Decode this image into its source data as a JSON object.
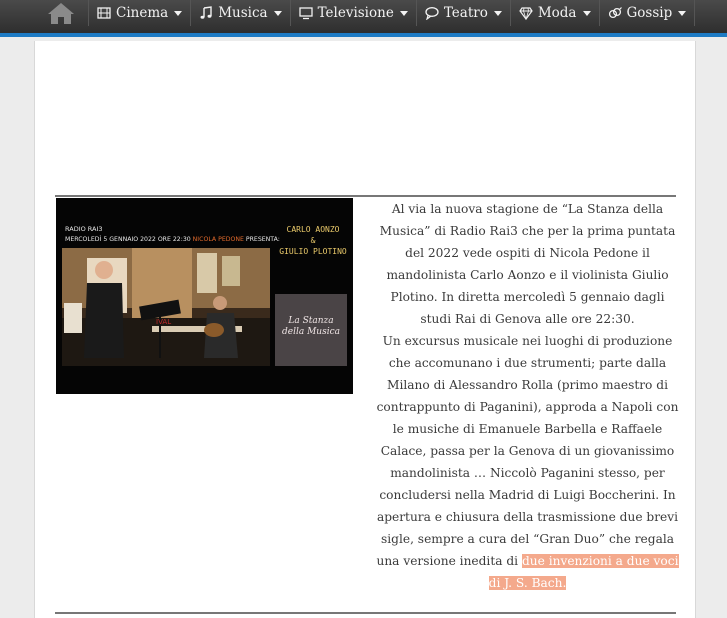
{
  "nav": {
    "items": [
      {
        "label": "Cinema",
        "icon": "film-icon"
      },
      {
        "label": "Musica",
        "icon": "music-note-icon"
      },
      {
        "label": "Televisione",
        "icon": "tv-icon"
      },
      {
        "label": "Teatro",
        "icon": "speech-bubble-icon"
      },
      {
        "label": "Moda",
        "icon": "diamond-icon"
      },
      {
        "label": "Gossip",
        "icon": "gender-symbol-icon"
      }
    ],
    "accent_color": "#1e7bc4"
  },
  "thumbnail": {
    "radio": "RADIO RAI3",
    "date_text": "MERCOLEDÌ 5 GENNAIO 2022 ORE 22:30",
    "host": "NICOLA PEDONE",
    "presents": "PRESENTA:",
    "artists_line1": "CARLO AONZO",
    "artists_amp": "&",
    "artists_line2": "GIULIO PLOTINO",
    "logo_text": "La Stanza della Musica",
    "festival_text": "IVAL"
  },
  "article": {
    "paragraph1": "Al via la nuova stagione de “La Stanza della Musica” di Radio Rai3 che per la prima puntata del 2022 vede ospiti di Nicola Pedone il mandolinista Carlo Aonzo e il violinista Giulio Plotino. In diretta mercoledì 5 gennaio dagli studi Rai di Genova alle ore 22:30.",
    "paragraph2": "Un excursus musicale nei luoghi di produzione che accomunano i due strumenti; parte dalla Milano di Alessandro Rolla (primo maestro di contrappunto di Paganini), approda a Napoli con le musiche di Emanuele Barbella e Raffaele Calace, passa per la Genova di un giovanissimo mandolinista … Niccolò Paganini stesso, per concludersi nella Madrid di Luigi Boccherini. In apertura e chiusura della trasmissione due brevi sigle, sempre a cura del “Gran Duo” che regala una versione inedita di",
    "highlight": "due invenzioni a due voci di J. S. Bach.",
    "highlight_color": "#f4a98c"
  }
}
